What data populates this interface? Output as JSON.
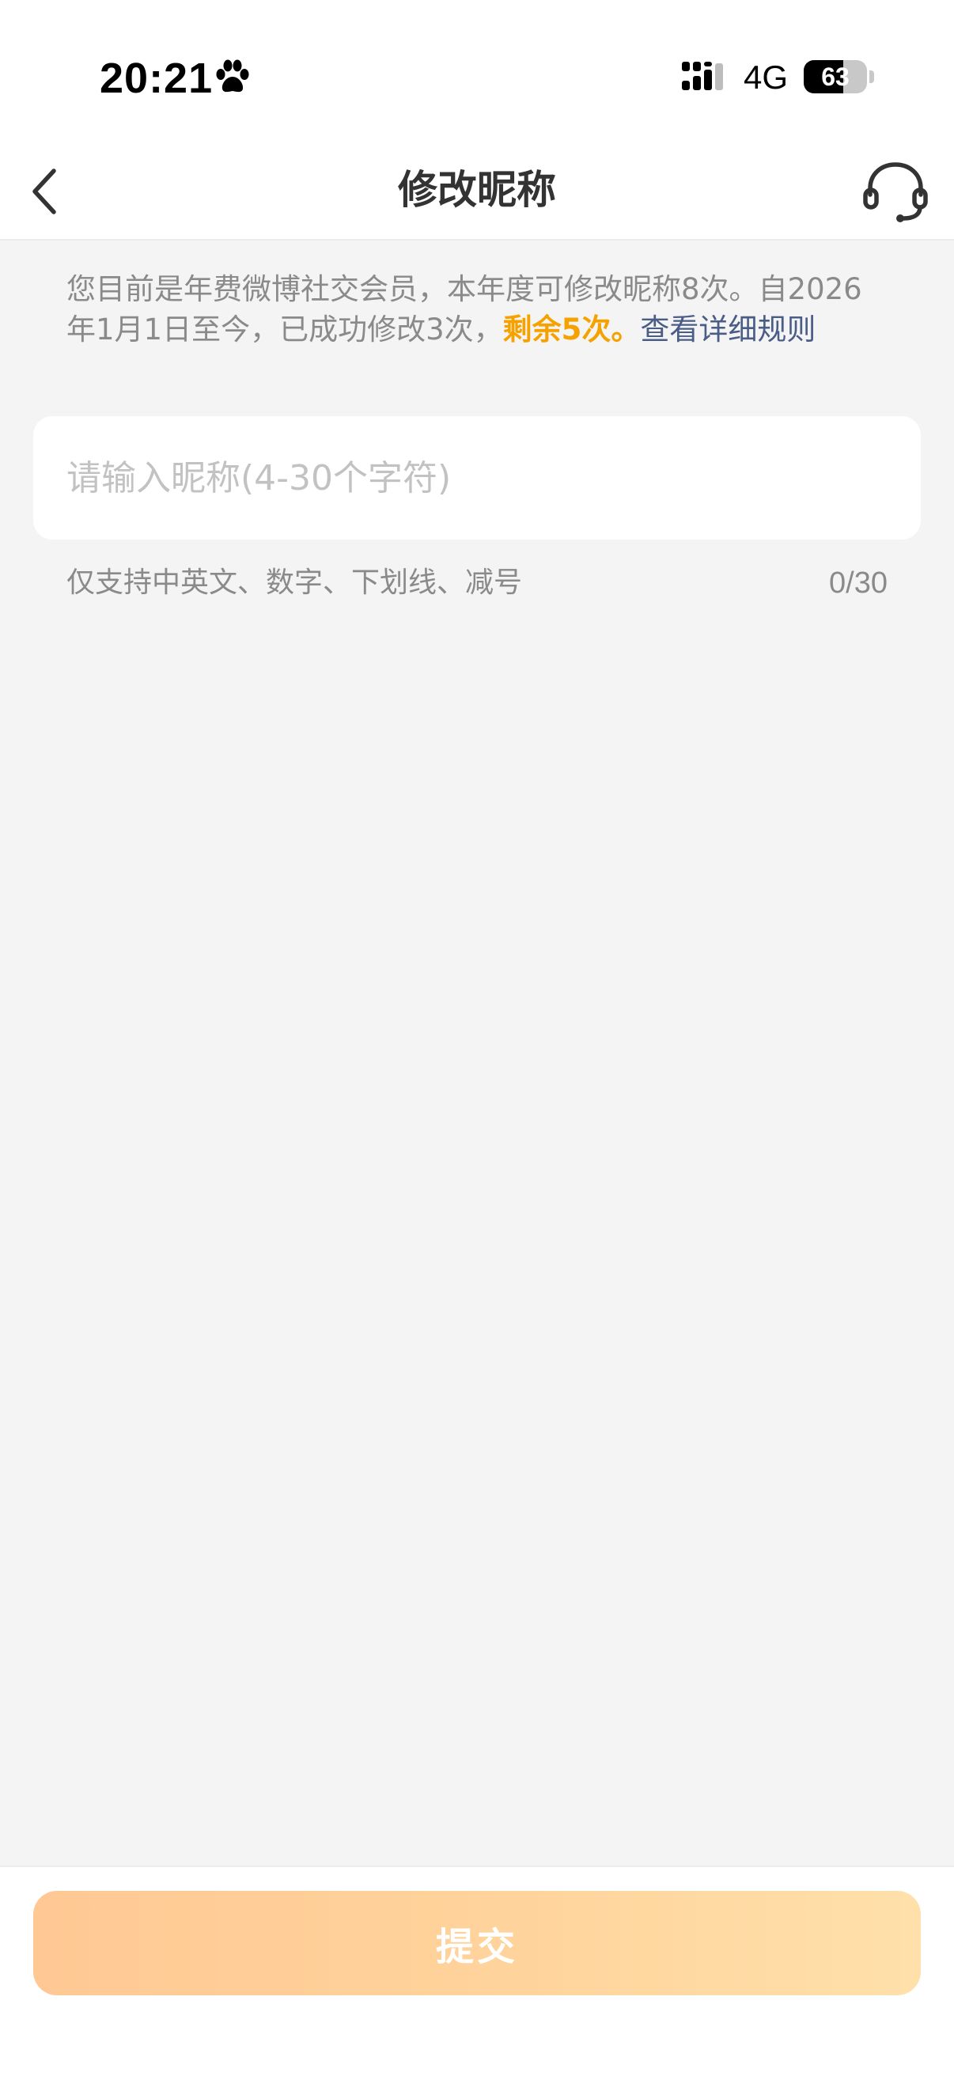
{
  "status_bar": {
    "time": "20:21",
    "network": "4G",
    "battery": {
      "level_text": "63",
      "level_fraction": 0.63
    },
    "icons": {
      "paw": "paw-icon",
      "signal": "signal-icon",
      "battery": "battery-icon"
    }
  },
  "nav": {
    "title": "修改昵称",
    "back_icon": "chevron-left-icon",
    "service_icon": "headset-icon"
  },
  "notice": {
    "text_main": "您目前是年费微博社交会员，本年度可修改昵称8次。自2026年1月1日至今，已成功修改3次，",
    "remaining": "剩余5次。",
    "rules_link": "查看详细规则",
    "highlight_color": "#f5a200",
    "link_color": "#4a5d87"
  },
  "nickname_input": {
    "value": "",
    "placeholder": "请输入昵称(4-30个字符)"
  },
  "hint": {
    "text": "仅支持中英文、数字、下划线、减号",
    "counter": "0/30"
  },
  "submit": {
    "label": "提交",
    "enabled": false
  }
}
